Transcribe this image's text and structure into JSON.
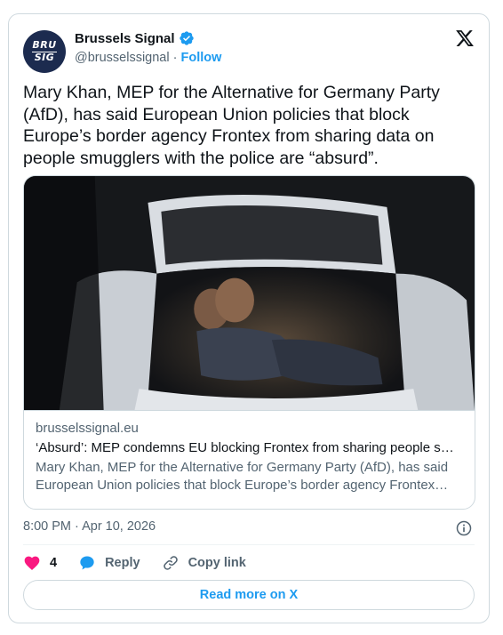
{
  "author": {
    "name": "Brussels Signal",
    "handle": "@brusselssignal",
    "separator": "·",
    "follow_label": "Follow",
    "avatar_line1": "BRU",
    "avatar_line2": "SIG",
    "verified_color": "#1d9bf0"
  },
  "tweet": {
    "text": "Mary Khan, MEP for the Alternative for Germany Party (AfD), has said European Union policies that block Europe’s border agency Frontex from sharing data on people smugglers with the police are “absurd”."
  },
  "link_card": {
    "domain": "brusselssignal.eu",
    "title": "‘Absurd’: MEP condemns EU blocking Frontex from sharing people smugglers data",
    "description": "Mary Khan, MEP for the Alternative for Germany Party (AfD), has said European Union policies that block Europe’s border agency Frontex from sharing data on people smugglers with the police are absurd."
  },
  "timestamp": "8:00 PM · Apr 10, 2026",
  "actions": {
    "like_count": "4",
    "reply_label": "Reply",
    "copy_link_label": "Copy link"
  },
  "read_more_label": "Read more on X",
  "colors": {
    "accent": "#1d9bf0",
    "like": "#f91880",
    "text": "#0f1419",
    "secondary": "#536471"
  }
}
